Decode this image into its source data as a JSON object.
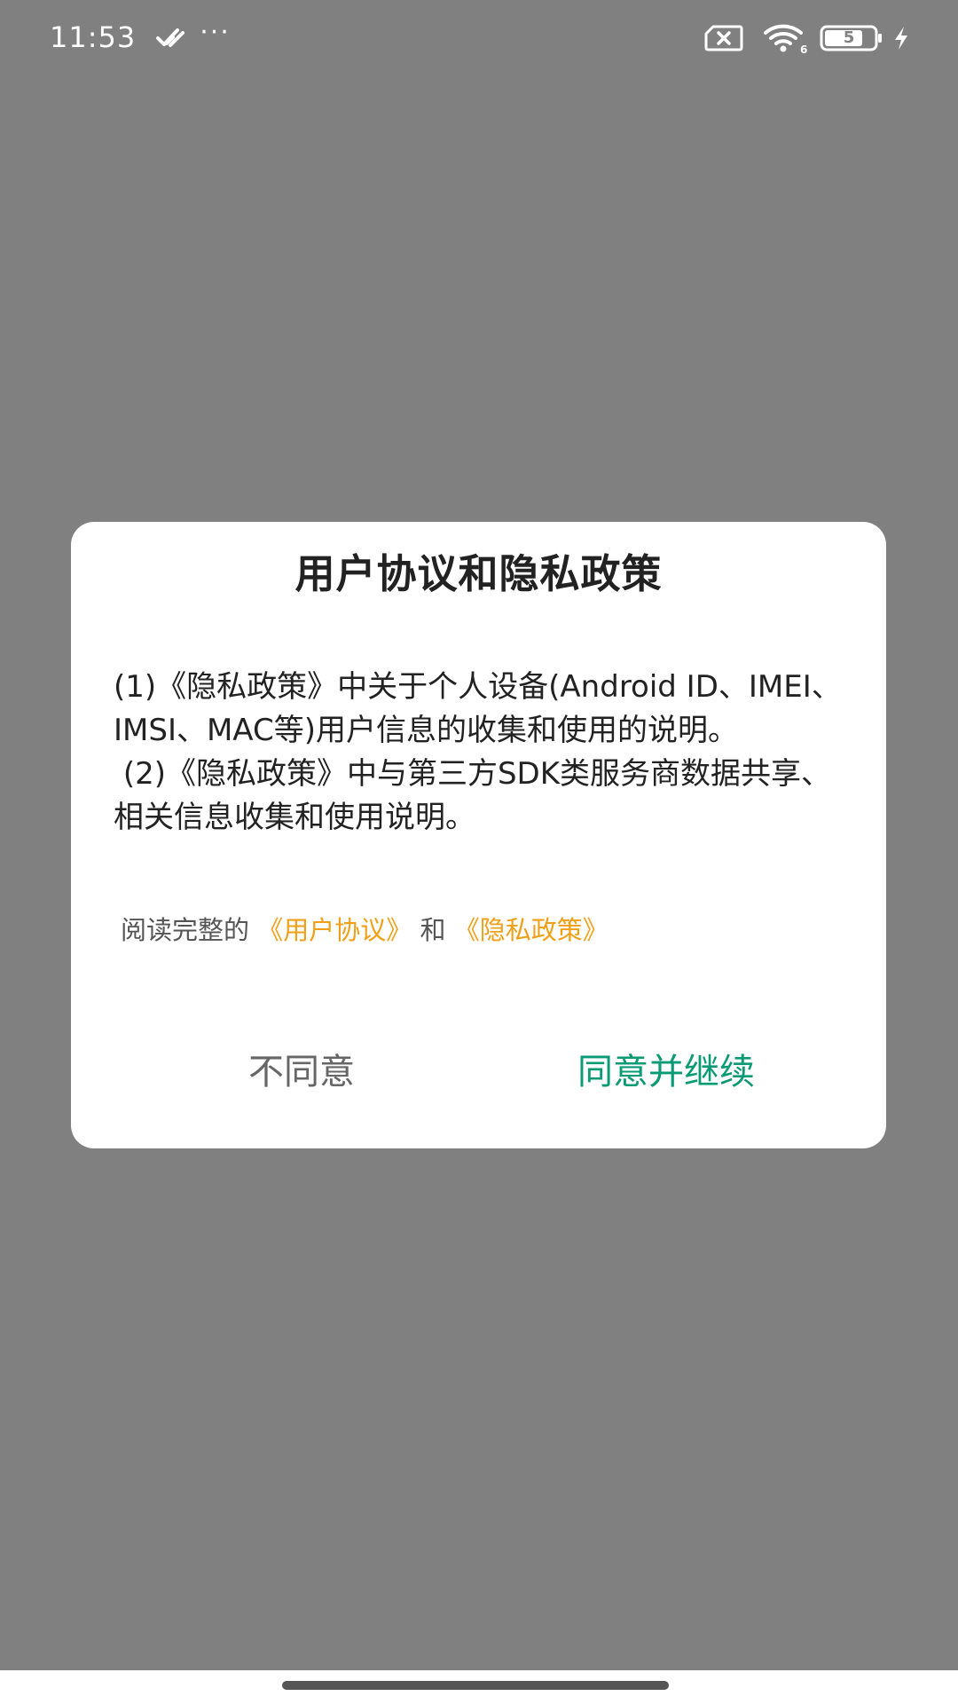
{
  "status_bar": {
    "time": "11:53",
    "more_indicator": "···",
    "wifi_badge": "6",
    "battery_level": "5",
    "icons": [
      "check-icon",
      "sim-card-x-icon",
      "wifi-icon",
      "battery-icon",
      "charging-bolt-icon"
    ]
  },
  "dialog": {
    "title": "用户协议和隐私政策",
    "paragraphs": [
      "(1)《隐私政策》中关于个人设备(Android ID、IMEI、IMSI、MAC等)用户信息的收集和使用的说明。",
      " (2)《隐私政策》中与第三方SDK类服务商数据共享、相关信息收集和使用说明。"
    ],
    "links_prefix": "阅读完整的",
    "user_agreement_link": "《用户协议》",
    "links_and": "和",
    "privacy_policy_link": "《隐私政策》",
    "disagree_label": "不同意",
    "agree_label": "同意并继续"
  },
  "colors": {
    "overlay": "#808080",
    "link": "#f0a018",
    "agree": "#0a9a74",
    "disagree": "#666666"
  }
}
